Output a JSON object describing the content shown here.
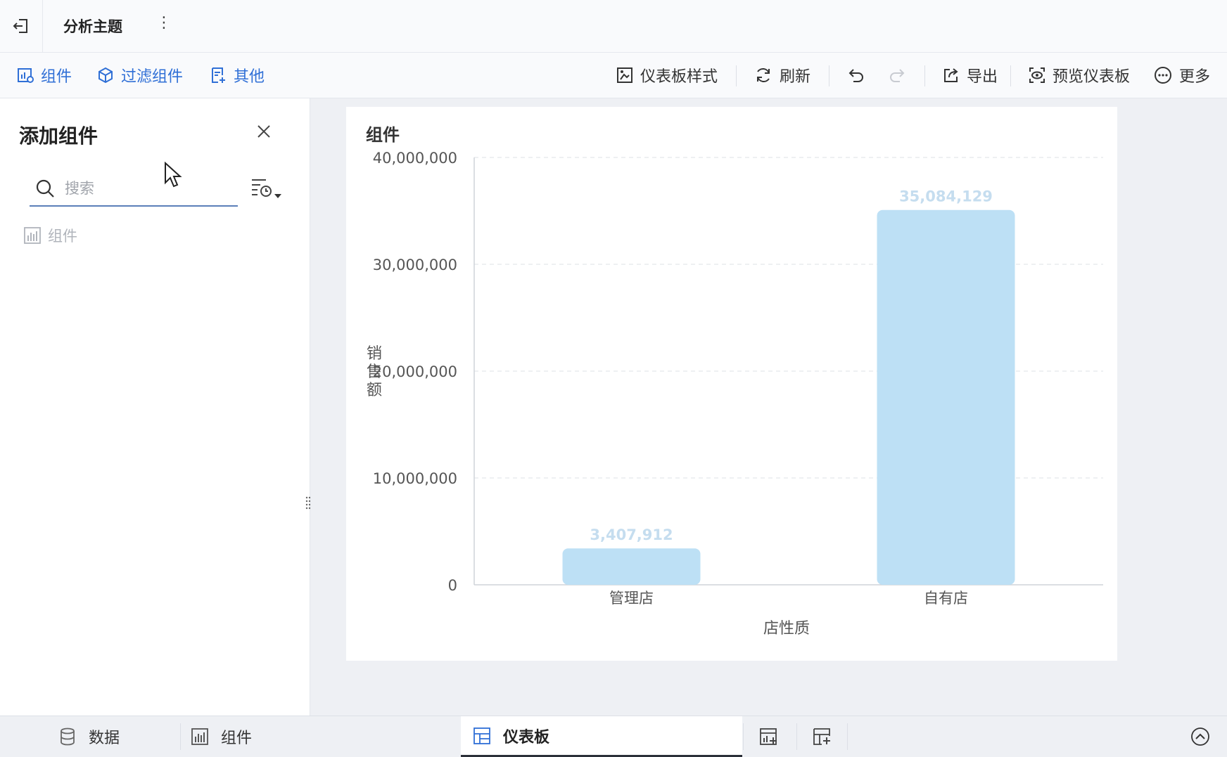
{
  "header": {
    "title": "分析主题"
  },
  "toolbar": {
    "left": [
      "组件",
      "过滤组件",
      "其他"
    ],
    "dashboard_style": "仪表板样式",
    "refresh": "刷新",
    "export": "导出",
    "preview": "预览仪表板",
    "more": "更多"
  },
  "panel": {
    "title": "添加组件",
    "search_placeholder": "搜索",
    "tree_item": "组件"
  },
  "card": {
    "title": "组件"
  },
  "chart_data": {
    "type": "bar",
    "categories": [
      "管理店",
      "自有店"
    ],
    "values": [
      3407912,
      35084129
    ],
    "value_labels": [
      "3,407,912",
      "35,084,129"
    ],
    "xlabel": "店性质",
    "ylabel": "销售额",
    "ylim": [
      0,
      40000000
    ],
    "yticks": [
      0,
      10000000,
      20000000,
      30000000,
      40000000
    ],
    "ytick_labels": [
      "0",
      "10,000,000",
      "20,000,000",
      "30,000,000",
      "40,000,000"
    ],
    "grid": true,
    "bar_color": "#bde0f5",
    "label_color": "#c5ddef"
  },
  "bottom": {
    "tabs": [
      "数据",
      "组件",
      "仪表板"
    ]
  }
}
